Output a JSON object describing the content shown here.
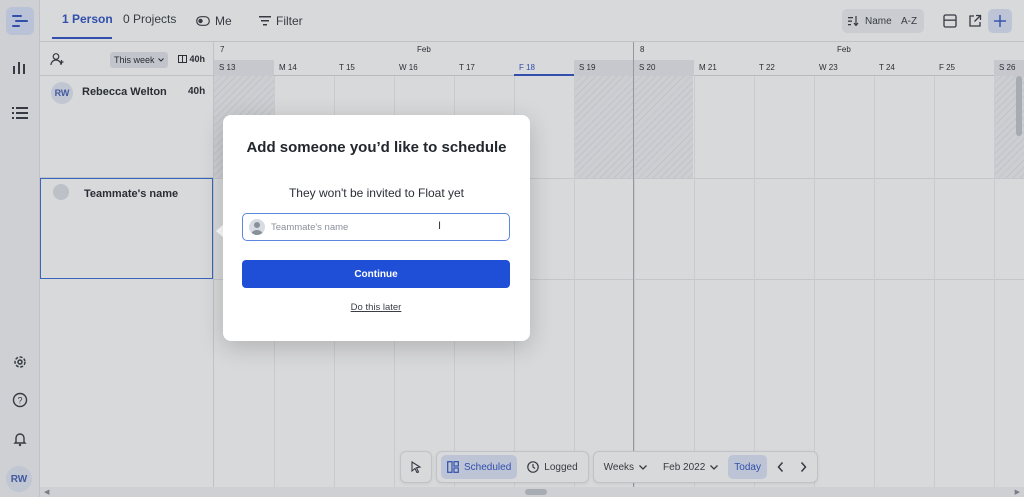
{
  "rail": {
    "items": [
      {
        "icon": "schedule-icon",
        "active": true
      },
      {
        "icon": "chart-icon",
        "active": false
      },
      {
        "icon": "list-icon",
        "active": false
      }
    ],
    "bottom_icons": [
      "gear-icon",
      "help-icon",
      "bell-icon"
    ],
    "avatar_initials": "RW"
  },
  "topbar": {
    "tabs": [
      {
        "label": "1 Person",
        "active": true
      },
      {
        "label": "0 Projects",
        "active": false
      }
    ],
    "me_label": "Me",
    "filter_label": "Filter",
    "sort_name_label": "Name",
    "sort_order_label": "A-Z"
  },
  "people_header": {
    "range_label": "This week",
    "hours_label": "40h"
  },
  "people": [
    {
      "initials": "RW",
      "name": "Rebecca Welton",
      "hours": "40h"
    }
  ],
  "placeholder_row": {
    "name": "Teammate's name"
  },
  "timeline": {
    "week_numbers": [
      "7",
      "8"
    ],
    "months": [
      "Feb",
      "Feb"
    ],
    "days": [
      {
        "label": "S 13",
        "weekend": true,
        "today": false
      },
      {
        "label": "M 14",
        "weekend": false,
        "today": false
      },
      {
        "label": "T 15",
        "weekend": false,
        "today": false
      },
      {
        "label": "W 16",
        "weekend": false,
        "today": false
      },
      {
        "label": "T 17",
        "weekend": false,
        "today": false
      },
      {
        "label": "F 18",
        "weekend": false,
        "today": true
      },
      {
        "label": "S 19",
        "weekend": true,
        "today": false
      },
      {
        "label": "S 20",
        "weekend": true,
        "today": false
      },
      {
        "label": "M 21",
        "weekend": false,
        "today": false
      },
      {
        "label": "T 22",
        "weekend": false,
        "today": false
      },
      {
        "label": "W 23",
        "weekend": false,
        "today": false
      },
      {
        "label": "T 24",
        "weekend": false,
        "today": false
      },
      {
        "label": "F 25",
        "weekend": false,
        "today": false
      },
      {
        "label": "S 26",
        "weekend": true,
        "today": false
      }
    ]
  },
  "dialog": {
    "title": "Add someone you’d like to schedule",
    "subtitle": "They won't be invited to Float yet",
    "input_placeholder": "Teammate's name",
    "input_value": "",
    "continue_label": "Continue",
    "later_label": "Do this later"
  },
  "bottombar": {
    "scheduled_label": "Scheduled",
    "logged_label": "Logged",
    "view_label": "Weeks",
    "month_label": "Feb 2022",
    "today_label": "Today"
  },
  "colors": {
    "accent": "#1f4fd6",
    "active_tab": "#3457c7",
    "highlight_bg": "#dfe6fb"
  }
}
